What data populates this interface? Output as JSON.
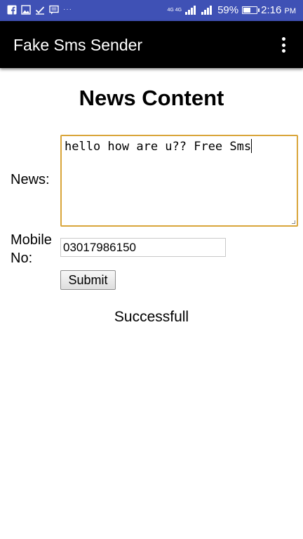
{
  "status_bar": {
    "network": "4G 4G",
    "battery_text": "59%",
    "battery_level": 0.59,
    "time": "2:16",
    "ampm": "PM",
    "bg_color": "#3f51b5",
    "left_icons": [
      "facebook-icon",
      "image-icon",
      "checkmark-icon",
      "message-icon",
      "more-notifications-icon"
    ],
    "right_icons": [
      "signal-icon",
      "signal-icon",
      "battery-icon"
    ]
  },
  "app_bar": {
    "title": "Fake Sms Sender",
    "menu_icon": "overflow-menu-icon"
  },
  "form": {
    "heading": "News Content",
    "news_label": "News:",
    "news_value": "hello how are u?? Free Sms",
    "mobile_label_line1": "Mobile",
    "mobile_label_line2": "No:",
    "mobile_value": "03017986150",
    "submit_label": "Submit",
    "result": "Successfull",
    "focus_border_color": "#d9a53a"
  }
}
